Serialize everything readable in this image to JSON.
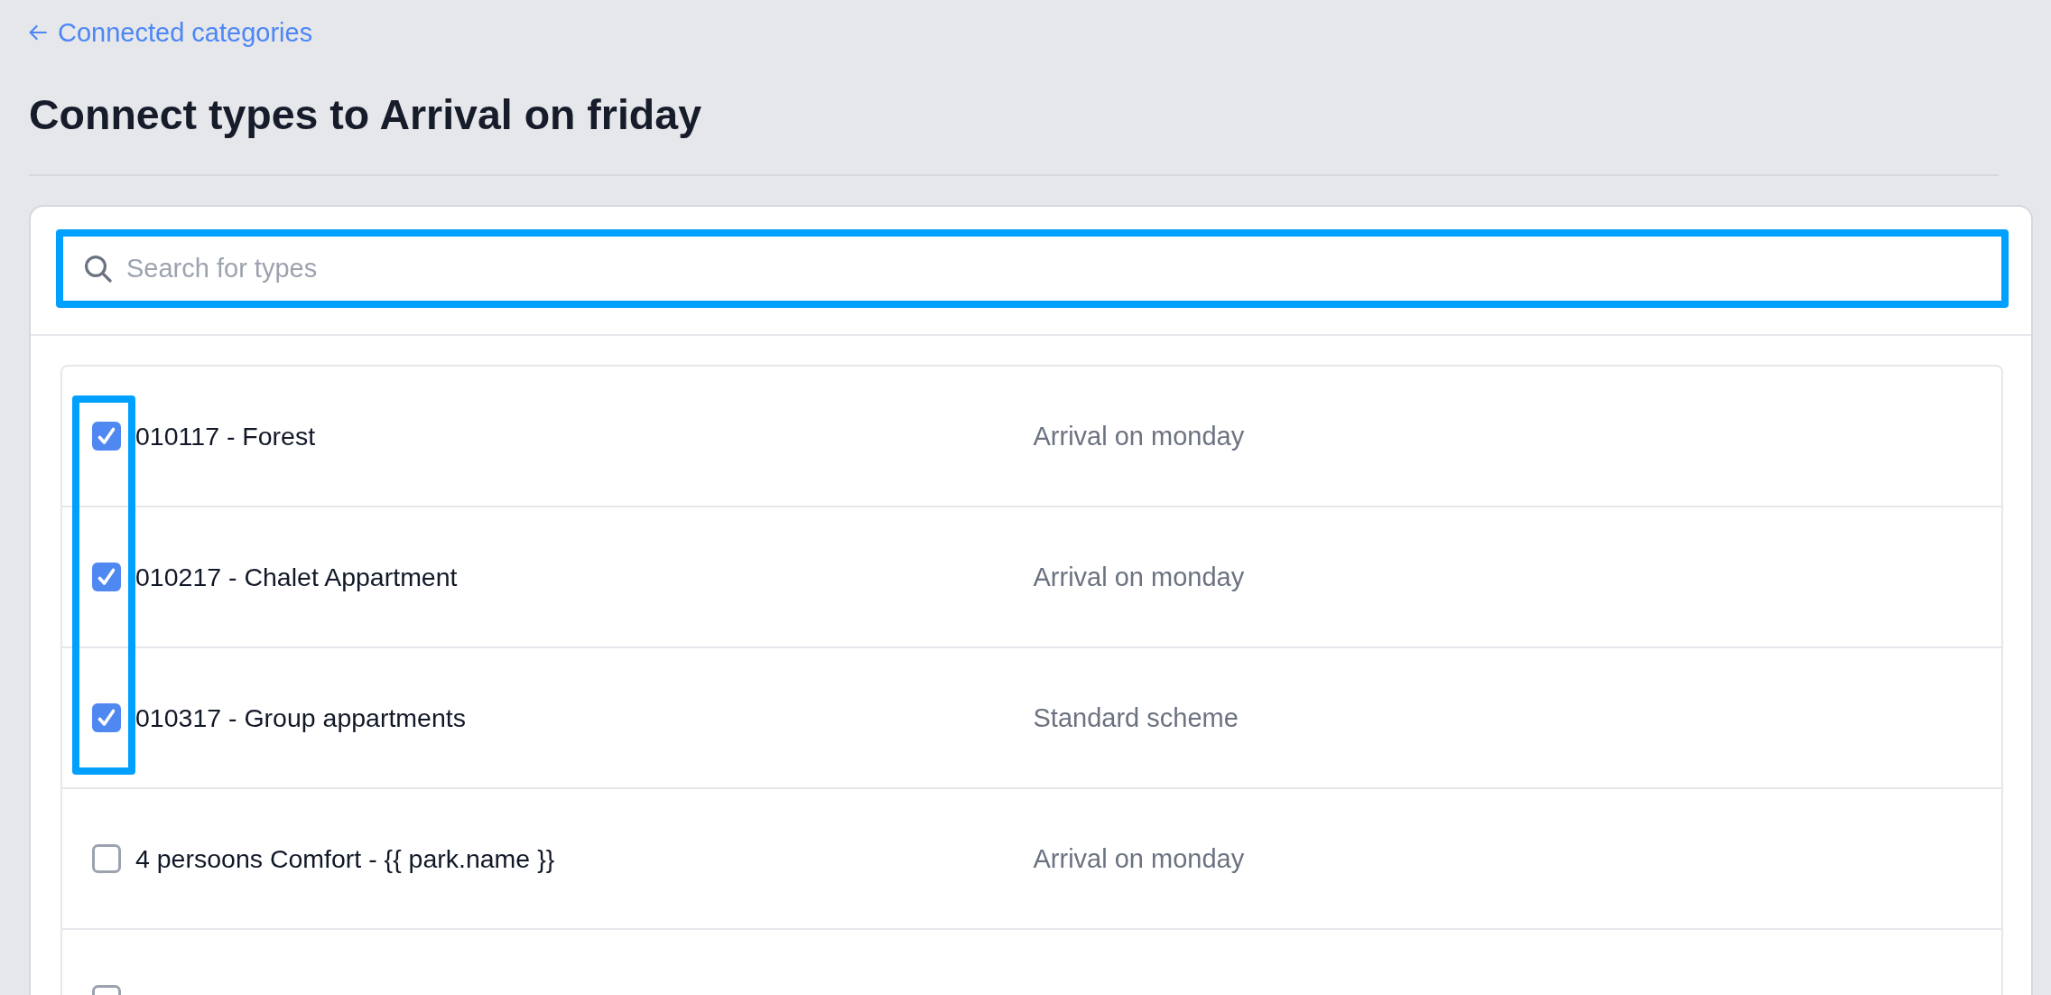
{
  "back_link": {
    "label": "Connected categories"
  },
  "title": "Connect types to Arrival on friday",
  "search": {
    "placeholder": "Search for types",
    "highlighted": true
  },
  "rows": [
    {
      "name": "010117 - Forest",
      "scheme": "Arrival on monday",
      "checked": true,
      "highlighted": true
    },
    {
      "name": "010217 - Chalet Appartment",
      "scheme": "Arrival on monday",
      "checked": true,
      "highlighted": true
    },
    {
      "name": "010317 - Group appartments",
      "scheme": "Standard scheme",
      "checked": true,
      "highlighted": true
    },
    {
      "name": "4 persoons Comfort - {{ park.name }}",
      "scheme": "Arrival on monday",
      "checked": false,
      "highlighted": false
    },
    {
      "checked": false,
      "highlighted": false
    }
  ]
}
